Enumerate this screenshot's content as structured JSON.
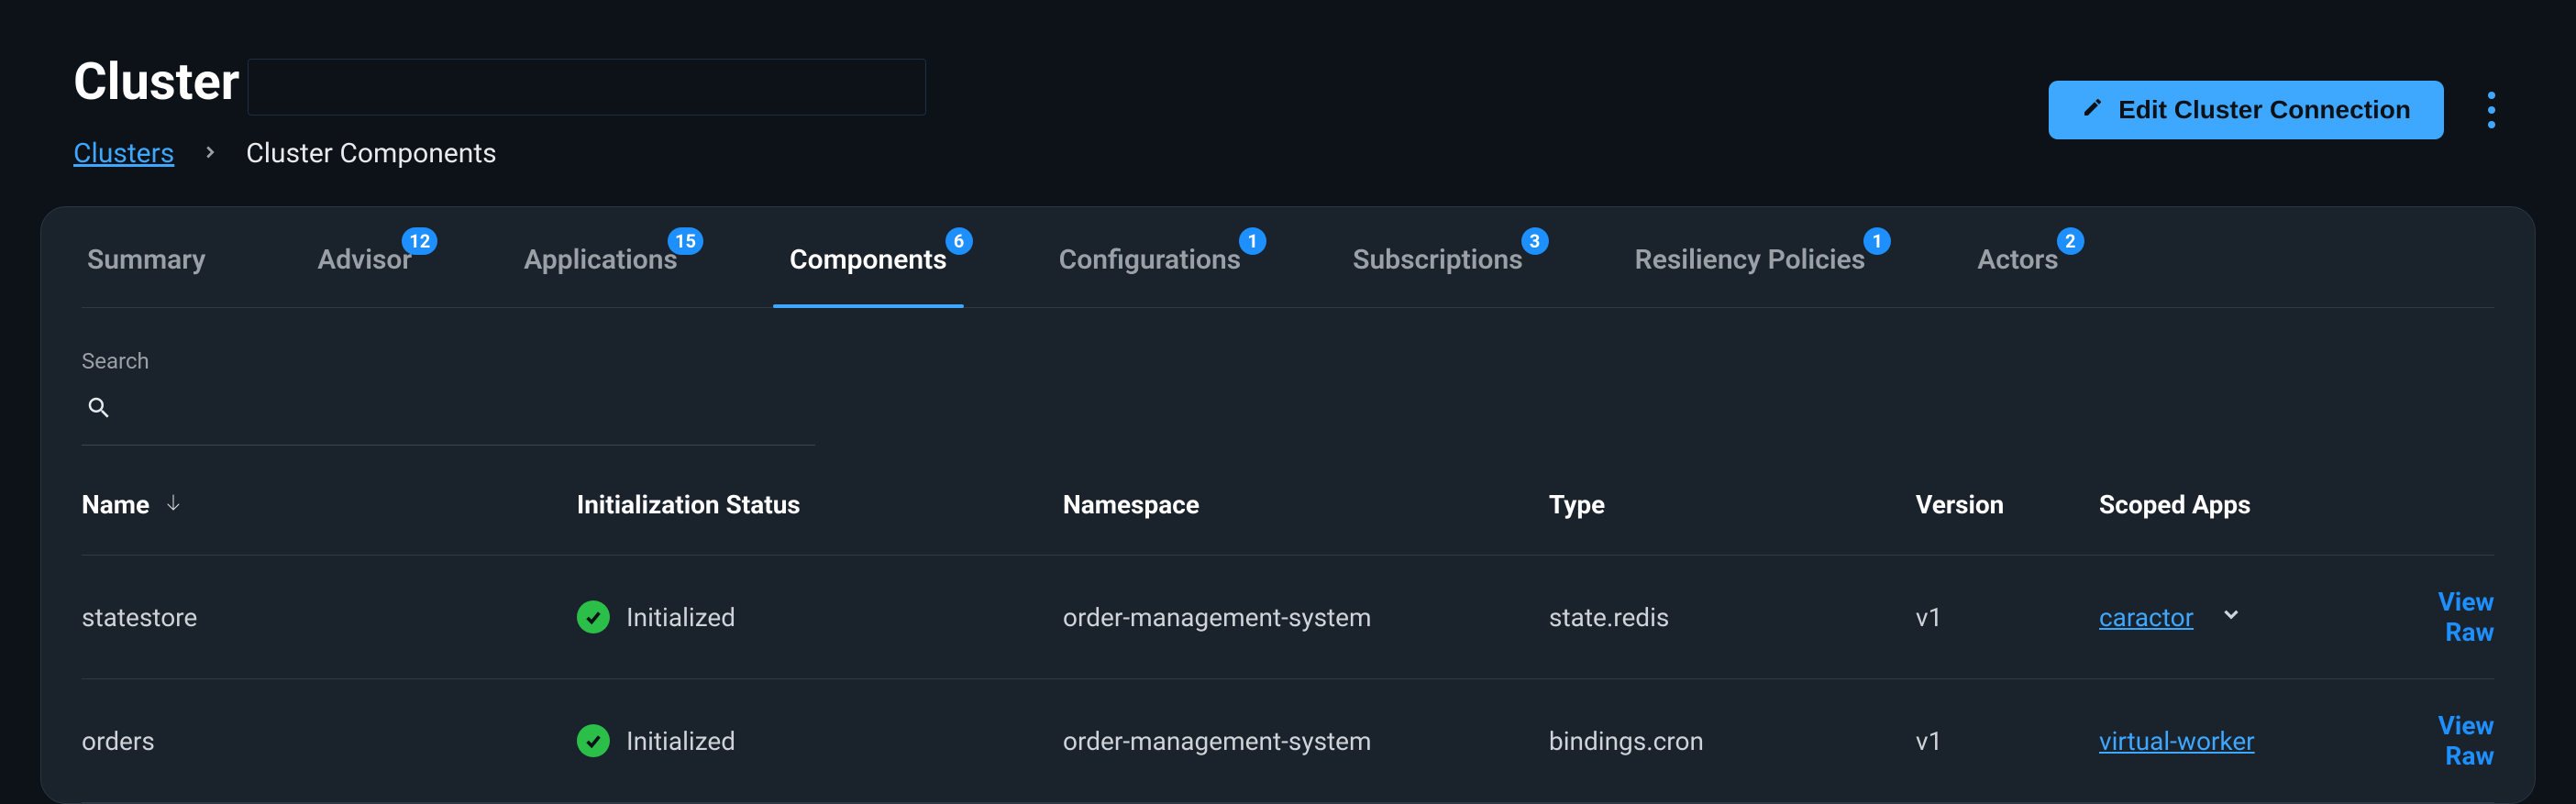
{
  "header": {
    "title": "Cluster",
    "edit_button_label": "Edit Cluster Connection"
  },
  "breadcrumb": {
    "root": "Clusters",
    "current": "Cluster Components"
  },
  "tabs": [
    {
      "label": "Summary",
      "badge": null,
      "active": false
    },
    {
      "label": "Advisor",
      "badge": "12",
      "active": false
    },
    {
      "label": "Applications",
      "badge": "15",
      "active": false
    },
    {
      "label": "Components",
      "badge": "6",
      "active": true
    },
    {
      "label": "Configurations",
      "badge": "1",
      "active": false
    },
    {
      "label": "Subscriptions",
      "badge": "3",
      "active": false
    },
    {
      "label": "Resiliency Policies",
      "badge": "1",
      "active": false
    },
    {
      "label": "Actors",
      "badge": "2",
      "active": false
    }
  ],
  "search": {
    "label": "Search",
    "value": ""
  },
  "table": {
    "columns": {
      "name": "Name",
      "init_status": "Initialization Status",
      "namespace": "Namespace",
      "type": "Type",
      "version": "Version",
      "scoped_apps": "Scoped Apps"
    },
    "rows": [
      {
        "name": "statestore",
        "init_status": "Initialized",
        "namespace": "order-management-system",
        "type": "state.redis",
        "version": "v1",
        "scoped_app": "caractor",
        "has_expand": true,
        "action": "View Raw"
      },
      {
        "name": "orders",
        "init_status": "Initialized",
        "namespace": "order-management-system",
        "type": "bindings.cron",
        "version": "v1",
        "scoped_app": "virtual-worker",
        "has_expand": false,
        "action": "View Raw"
      }
    ]
  }
}
